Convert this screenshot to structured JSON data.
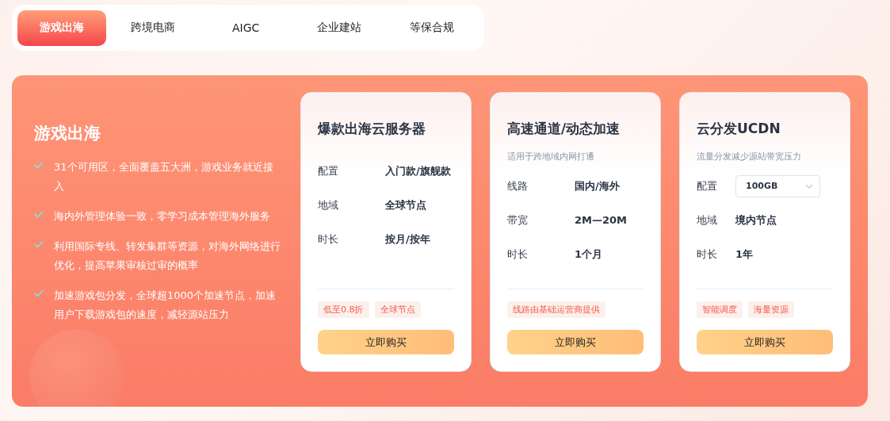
{
  "tabs": [
    {
      "label": "游戏出海",
      "selected": true
    },
    {
      "label": "跨境电商",
      "selected": false
    },
    {
      "label": "AIGC",
      "selected": false
    },
    {
      "label": "企业建站",
      "selected": false
    },
    {
      "label": "等保合规",
      "selected": false
    }
  ],
  "panel": {
    "title": "游戏出海",
    "features": [
      "31个可用区，全面覆盖五大洲，游戏业务就近接入",
      "海内外管理体验一致，零学习成本管理海外服务",
      "利用国际专线、转发集群等资源，对海外网络进行优化，提高苹果审核过审的概率",
      "加速游戏包分发，全球超1000个加速节点，加速用户下载游戏包的速度，减轻源站压力"
    ]
  },
  "cards": [
    {
      "title": "爆款出海云服务器",
      "rows": [
        {
          "kind": "text",
          "label": "配置",
          "value": "入门款/旗舰款"
        },
        {
          "kind": "text",
          "label": "地域",
          "value": "全球节点"
        },
        {
          "kind": "text",
          "label": "时长",
          "value": "按月/按年"
        }
      ],
      "tags": [
        "低至0.8折",
        "全球节点"
      ],
      "button": "立即购买"
    },
    {
      "title": "高速通道/动态加速",
      "subtitle": "适用于跨地域内网打通",
      "rows": [
        {
          "kind": "text",
          "label": "线路",
          "value": "国内/海外"
        },
        {
          "kind": "text",
          "label": "带宽",
          "value": "2M—20M"
        },
        {
          "kind": "text",
          "label": "时长",
          "value": "1个月"
        }
      ],
      "tags": [
        "线路由基础运营商提供"
      ],
      "button": "立即购买"
    },
    {
      "title": "云分发UCDN",
      "subtitle": "流量分发减少源站带宽压力",
      "rows": [
        {
          "kind": "select",
          "label": "配置",
          "value": "100GB"
        },
        {
          "kind": "text",
          "label": "地域",
          "value": "境内节点"
        },
        {
          "kind": "text",
          "label": "时长",
          "value": "1年"
        }
      ],
      "tags": [
        "智能调度",
        "海量资源"
      ],
      "button": "立即购买"
    }
  ]
}
